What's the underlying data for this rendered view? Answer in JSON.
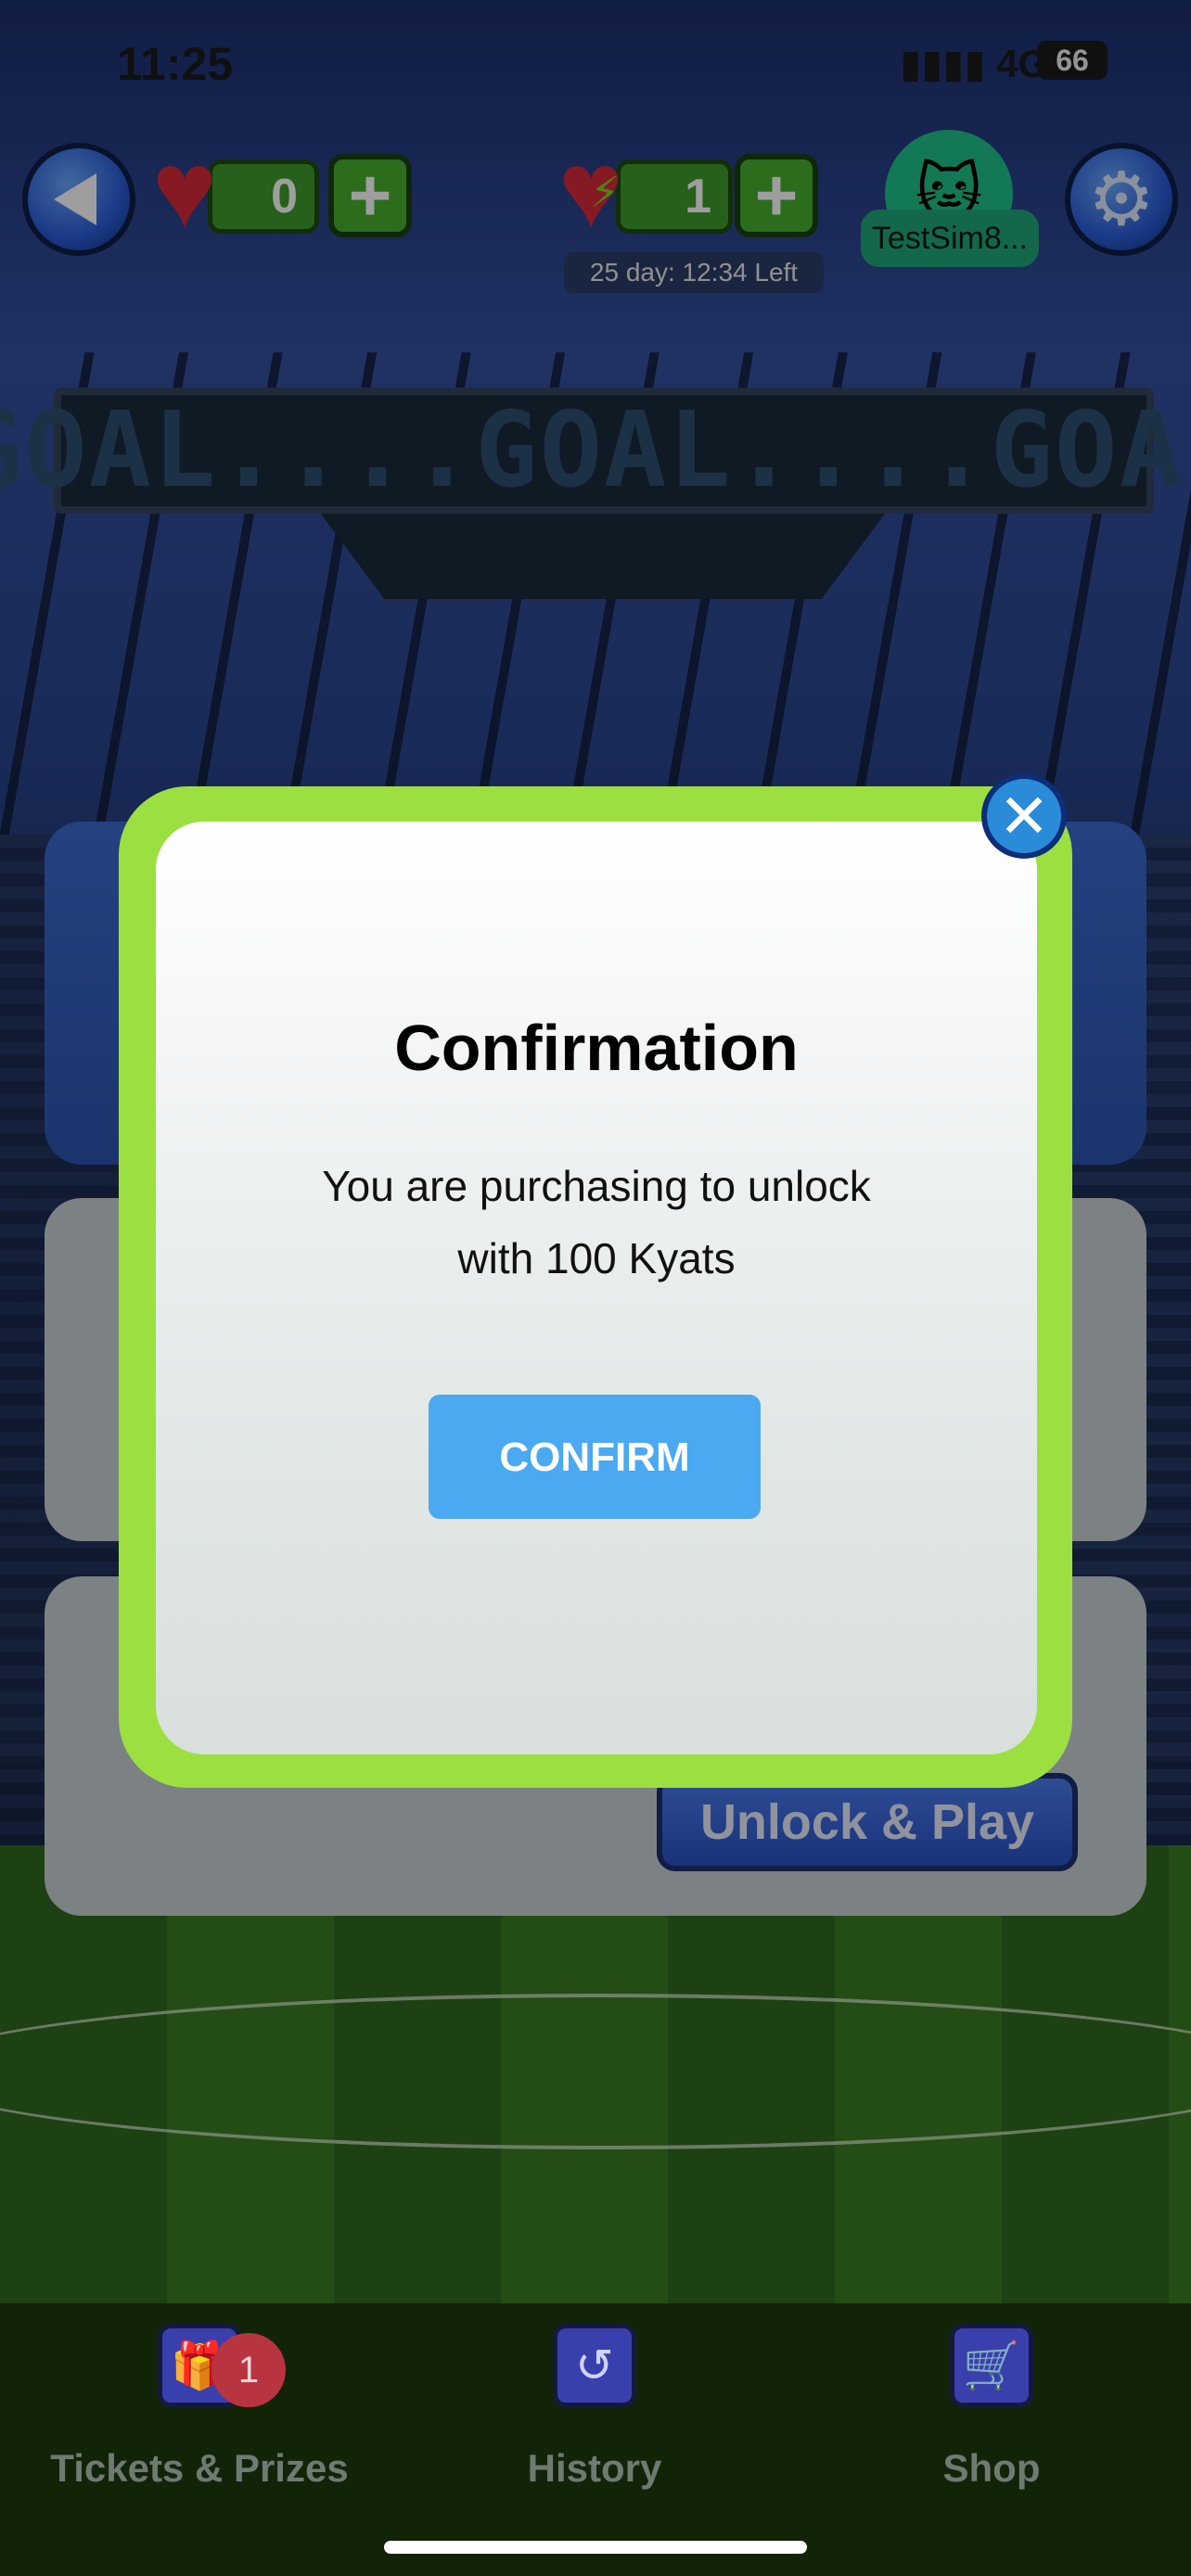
{
  "status_bar": {
    "time": "11:25",
    "network": "4G",
    "battery": "66"
  },
  "hud": {
    "lives_count": "0",
    "energy_count": "1",
    "timer": "25 day: 12:34 Left",
    "username": "TestSim8..."
  },
  "scoreboard": {
    "text": "GOAL....GOAL....GOAL"
  },
  "background": {
    "unlock_button": "Unlock & Play"
  },
  "modal": {
    "title": "Confirmation",
    "message_line1": "You are purchasing to unlock",
    "message_line2": "with 100 Kyats",
    "confirm_label": "CONFIRM",
    "close_glyph": "✕"
  },
  "bottom_nav": {
    "tickets": {
      "label": "Tickets & Prizes",
      "badge": "1",
      "icon": "gift-icon"
    },
    "history": {
      "label": "History",
      "icon": "history-icon"
    },
    "shop": {
      "label": "Shop",
      "icon": "cart-icon"
    }
  },
  "colors": {
    "modal_frame": "#9be040",
    "confirm_button": "#4aa9f0",
    "nav_background": "#122408"
  }
}
